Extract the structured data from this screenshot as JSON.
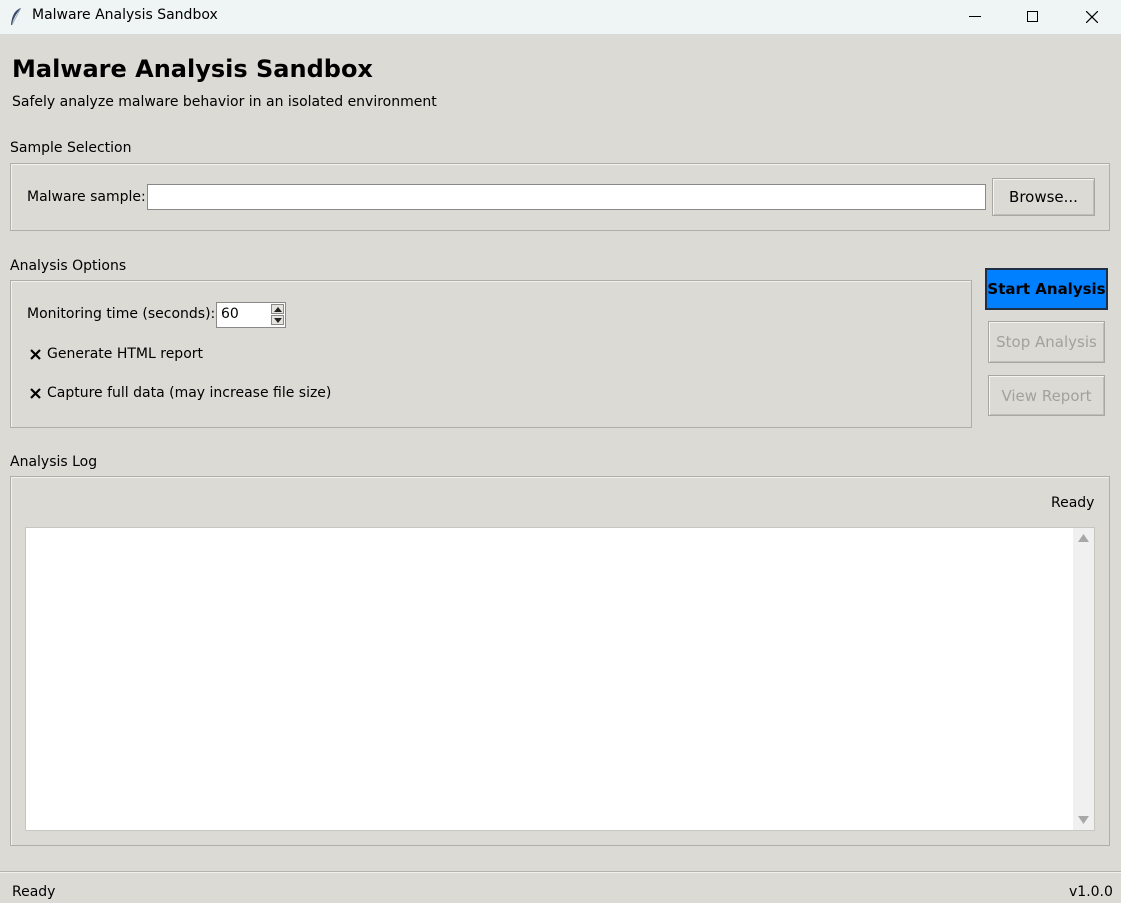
{
  "window": {
    "title": "Malware Analysis Sandbox",
    "controls": [
      "minimize-icon",
      "maximize-icon",
      "close-icon"
    ]
  },
  "header": {
    "title": "Malware Analysis Sandbox",
    "subtitle": "Safely analyze malware behavior in an isolated environment"
  },
  "sample_selection": {
    "section_label": "Sample Selection",
    "field_label": "Malware sample:",
    "value": "",
    "browse_label": "Browse..."
  },
  "analysis_options": {
    "section_label": "Analysis Options",
    "monitoring_label": "Monitoring time (seconds):",
    "monitoring_value": "60",
    "options": [
      {
        "label": "Generate HTML report",
        "checked": true
      },
      {
        "label": "Capture full data (may increase file size)",
        "checked": true
      }
    ]
  },
  "actions": {
    "start_label": "Start Analysis",
    "stop_label": "Stop Analysis",
    "view_label": "View Report",
    "start_color": "#007fff"
  },
  "log": {
    "section_label": "Analysis Log",
    "status": "Ready",
    "content": ""
  },
  "statusbar": {
    "status": "Ready",
    "version": "v1.0.0"
  }
}
